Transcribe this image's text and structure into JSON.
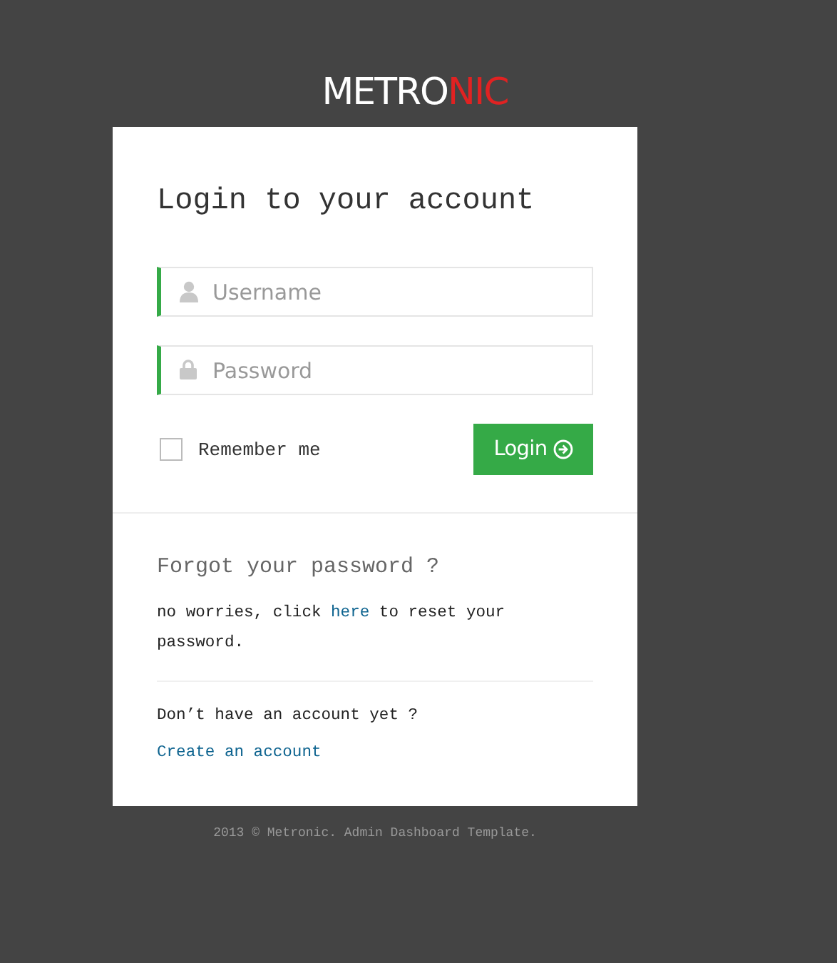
{
  "logo": {
    "text": "METRO",
    "accent": "NIC"
  },
  "login": {
    "title": "Login to your account",
    "fields": [
      {
        "kind": "user",
        "placeholder": "Username"
      },
      {
        "kind": "lock",
        "placeholder": "Password"
      }
    ],
    "remember": {
      "label": "Remember me",
      "checked": false
    },
    "button": "Login"
  },
  "forgot": {
    "title": "Forgot your password ?",
    "before": "no worries, click ",
    "link": "here",
    "after": " to reset your password."
  },
  "signup": {
    "question": "Don’t have an account yet ?",
    "link": "Create an account"
  },
  "footer": "2013 © Metronic. Admin Dashboard Template."
}
